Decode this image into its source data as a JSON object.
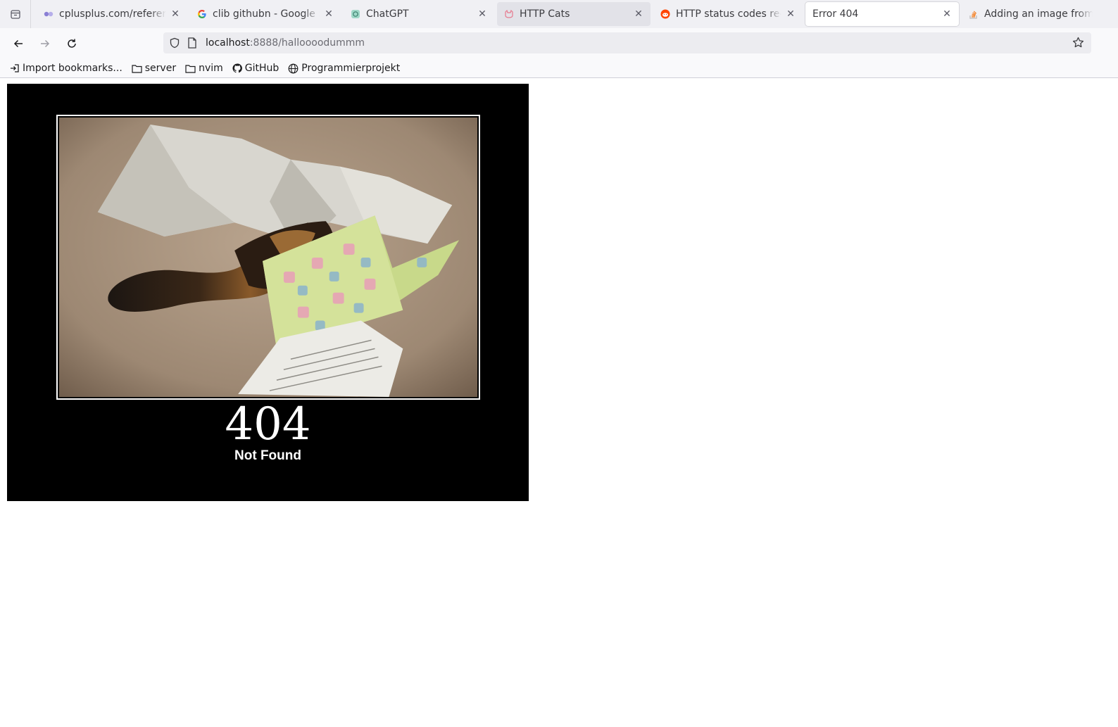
{
  "tabs": [
    {
      "label": "cplusplus.com/reference",
      "icon": "cplusplus-icon",
      "state": "normal"
    },
    {
      "label": "clib githubn - Google Suche",
      "icon": "google-icon",
      "state": "normal"
    },
    {
      "label": "ChatGPT",
      "icon": "chatgpt-icon",
      "state": "normal"
    },
    {
      "label": "HTTP Cats",
      "icon": "httpcats-icon",
      "state": "hover"
    },
    {
      "label": "HTTP status codes re-enabled",
      "icon": "reddit-icon",
      "state": "normal"
    },
    {
      "label": "Error 404",
      "icon": "none",
      "state": "active"
    },
    {
      "label": "Adding an image from a",
      "icon": "stackoverflow-icon",
      "state": "normal"
    }
  ],
  "navbar": {
    "url_host": "localhost",
    "url_rest": ":8888/halloooodummm"
  },
  "bookmarks": [
    {
      "label": "Import bookmarks...",
      "icon": "import-icon"
    },
    {
      "label": "server",
      "icon": "folder-icon"
    },
    {
      "label": "nvim",
      "icon": "folder-icon"
    },
    {
      "label": "GitHub",
      "icon": "github-icon"
    },
    {
      "label": "Programmierprojekt",
      "icon": "globe-icon"
    }
  ],
  "page": {
    "status_code": "404",
    "status_text": "Not Found"
  },
  "colors": {
    "card_background": "#000000",
    "tab_strip": "#f0f0f4",
    "url_field": "#ececf0"
  }
}
